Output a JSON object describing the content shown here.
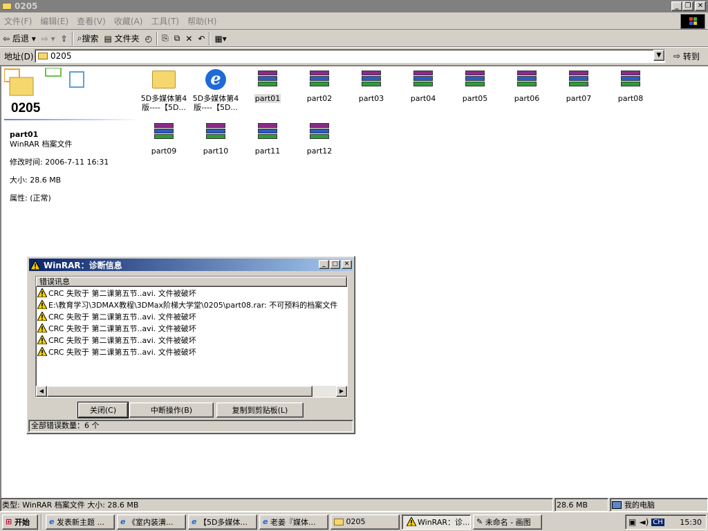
{
  "window": {
    "title": "0205"
  },
  "menu": [
    "文件(F)",
    "编辑(E)",
    "查看(V)",
    "收藏(A)",
    "工具(T)",
    "帮助(H)"
  ],
  "toolbar": {
    "back": "后退",
    "search": "搜索",
    "folders": "文件夹"
  },
  "address": {
    "label": "地址(D)",
    "value": "0205",
    "go": "转到"
  },
  "sidebar": {
    "folder_title": "0205",
    "selected_name": "part01",
    "selected_type": "WinRAR 档案文件",
    "modified": "修改时间: 2006-7-11 16:31",
    "size": "大小: 28.6 MB",
    "attributes": "属性: (正常)"
  },
  "files": [
    {
      "name": "5D多媒体第4版----【5D...",
      "kind": "folder"
    },
    {
      "name": "5D多媒体第4版----【5D...",
      "kind": "ie"
    },
    {
      "name": "part01",
      "kind": "rar"
    },
    {
      "name": "part02",
      "kind": "rar"
    },
    {
      "name": "part03",
      "kind": "rar"
    },
    {
      "name": "part04",
      "kind": "rar"
    },
    {
      "name": "part05",
      "kind": "rar"
    },
    {
      "name": "part06",
      "kind": "rar"
    },
    {
      "name": "part07",
      "kind": "rar"
    },
    {
      "name": "part08",
      "kind": "rar"
    },
    {
      "name": "part09",
      "kind": "rar"
    },
    {
      "name": "part10",
      "kind": "rar"
    },
    {
      "name": "part11",
      "kind": "rar"
    },
    {
      "name": "part12",
      "kind": "rar"
    }
  ],
  "dialog": {
    "title": "WinRAR：诊断信息",
    "header": "错误讯息",
    "messages": [
      "CRC 失败于 第二课第五节..avi. 文件被破坏",
      "E:\\教育学习\\3DMAX教程\\3DMax阶梯大学堂\\0205\\part08.rar: 不可预料的档案文件",
      "CRC 失败于 第二课第五节..avi. 文件被破坏",
      "CRC 失败于 第二课第五节..avi. 文件被破坏",
      "CRC 失败于 第二课第五节..avi. 文件被破坏",
      "CRC 失败于 第二课第五节..avi. 文件被破坏"
    ],
    "close": "关闭(C)",
    "abort": "中断操作(B)",
    "copy": "复制到剪贴板(L)",
    "total": "全部错误数量：6 个"
  },
  "status": {
    "left": "类型: WinRAR 档案文件 大小: 28.6 MB",
    "size": "28.6 MB",
    "zone": "我的电脑"
  },
  "taskbar": {
    "start": "开始",
    "tasks": [
      "发表新主题 ...",
      "《室内装潢...",
      "【5D多媒体...",
      "老姜『媒体...",
      "0205",
      "WinRAR：诊...",
      "未命名 - 画图"
    ],
    "lang": "CH",
    "clock": "15:30"
  }
}
